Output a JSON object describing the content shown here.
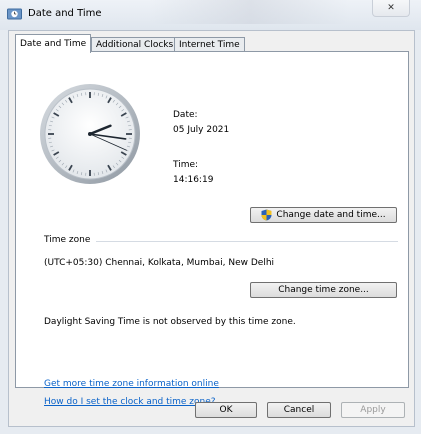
{
  "window": {
    "title": "Date and Time",
    "close_glyph": "✕",
    "icon": "clock-window-icon"
  },
  "tabs": [
    {
      "label": "Date and Time",
      "active": true
    },
    {
      "label": "Additional Clocks",
      "active": false
    },
    {
      "label": "Internet Time",
      "active": false
    }
  ],
  "clock": {
    "hours": 14,
    "minutes": 16,
    "seconds": 19,
    "face_color": "#f4f6f8",
    "ring_color": "#a8b0b8",
    "hand_color": "#1d2630"
  },
  "date_section": {
    "date_label": "Date:",
    "date_value": "05 July 2021",
    "time_label": "Time:",
    "time_value": "14:16:19",
    "change_button": "Change date and time...",
    "button_icon": "uac-shield-icon"
  },
  "timezone_section": {
    "heading": "Time zone",
    "value": "(UTC+05:30) Chennai, Kolkata, Mumbai, New Delhi",
    "change_button": "Change time zone...",
    "dst_note": "Daylight Saving Time is not observed by this time zone."
  },
  "links": {
    "more_info": "Get more time zone information online",
    "how_to": "How do I set the clock and time zone?"
  },
  "footer": {
    "ok": "OK",
    "cancel": "Cancel",
    "apply": "Apply"
  },
  "colors": {
    "link": "#0b63c9",
    "window_bg": "#e6ebf1",
    "panel_bg": "#ffffff"
  }
}
